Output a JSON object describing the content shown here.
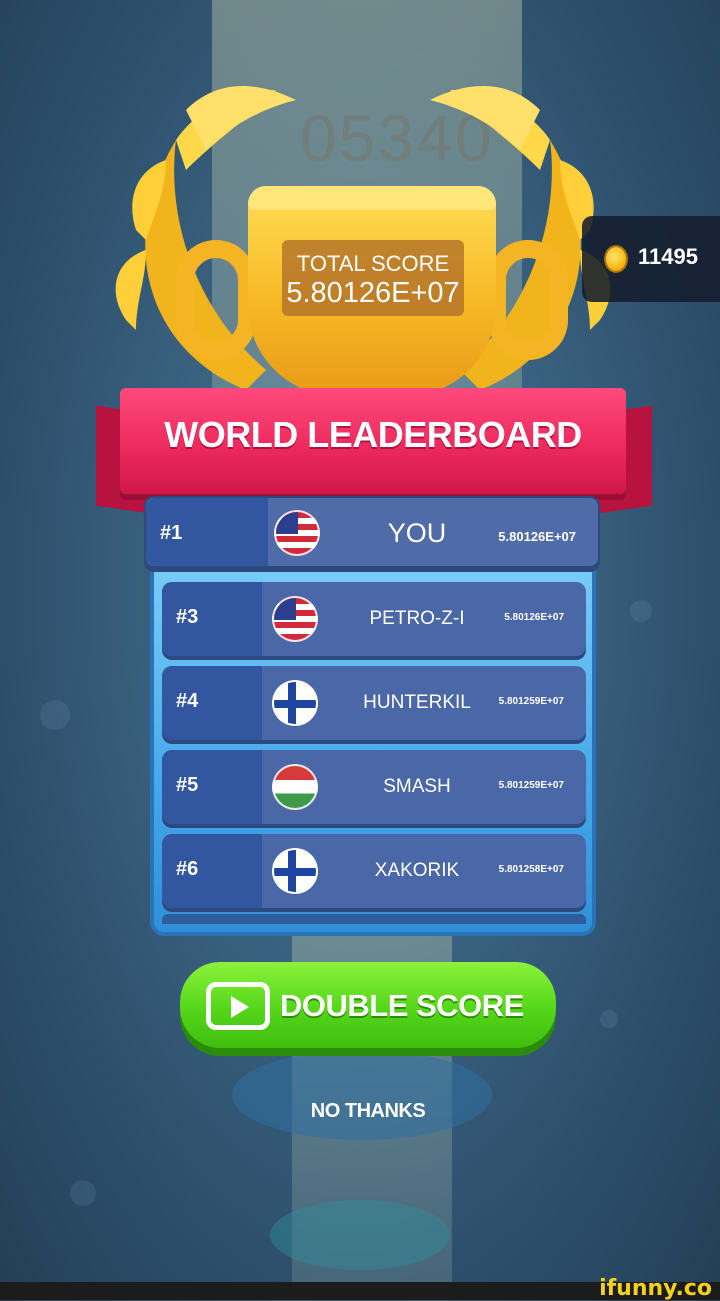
{
  "background": {
    "score_ghost": "05340"
  },
  "hud": {
    "coins": "11495",
    "coin_icon": "coin-icon"
  },
  "trophy": {
    "total_score_label": "TOTAL SCORE",
    "total_score_value": "5.80126E+07"
  },
  "leaderboard": {
    "title": "WORLD LEADERBOARD",
    "player": {
      "rank": "#1",
      "flag": "us",
      "name": "YOU",
      "score": "5.80126E+07"
    },
    "rows": [
      {
        "rank": "#3",
        "flag": "us",
        "name": "PETRO-Z-I",
        "score": "5.80126E+07"
      },
      {
        "rank": "#4",
        "flag": "fi",
        "name": "HUNTERKIL",
        "score": "5.801259E+07"
      },
      {
        "rank": "#5",
        "flag": "hu",
        "name": "SMASH",
        "score": "5.801259E+07"
      },
      {
        "rank": "#6",
        "flag": "fi",
        "name": "XAKORIK",
        "score": "5.801258E+07"
      }
    ]
  },
  "actions": {
    "double_score_label": "DOUBLE SCORE",
    "double_score_icon": "play-video-icon",
    "no_thanks_label": "NO THANKS"
  },
  "watermark": "ifunny.co",
  "colors": {
    "ribbon": "#ee2a5e",
    "panel": "#46a8ea",
    "button_green": "#55d61a",
    "trophy_gold": "#f7b926"
  }
}
